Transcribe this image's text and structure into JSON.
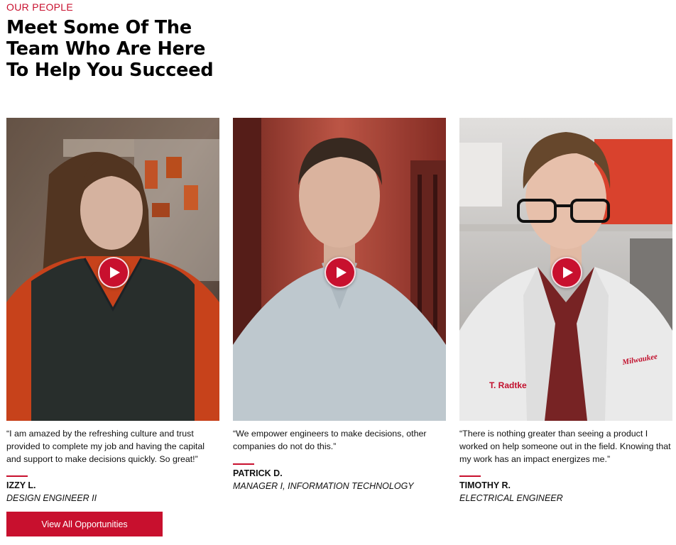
{
  "section": {
    "eyebrow": "OUR PEOPLE",
    "headline": "Meet Some Of The Team Who Are Here To Help You Succeed"
  },
  "people": [
    {
      "quote": "“I am amazed by the refreshing culture and trust provided to complete my job and having the capital and support to make decisions quickly. So great!”",
      "name": "IZZY L.",
      "role": "DESIGN ENGINEER II",
      "play_icon": "play-icon"
    },
    {
      "quote": "“We empower engineers to make decisions, other companies do not do this.”",
      "name": "PATRICK D.",
      "role": "MANAGER I, INFORMATION TECHNOLOGY",
      "play_icon": "play-icon"
    },
    {
      "quote": "“There is nothing greater than seeing a product I worked on help someone out in the field. Knowing that my work has an impact energizes me.”",
      "name": "TIMOTHY R.",
      "role": "ELECTRICAL ENGINEER",
      "play_icon": "play-icon",
      "coat_name_tag": "T. Radtke",
      "coat_logo": "Milwaukee"
    }
  ],
  "cta": {
    "label": "View All Opportunities"
  },
  "colors": {
    "accent": "#c8102e",
    "text": "#111111",
    "background": "#ffffff"
  }
}
